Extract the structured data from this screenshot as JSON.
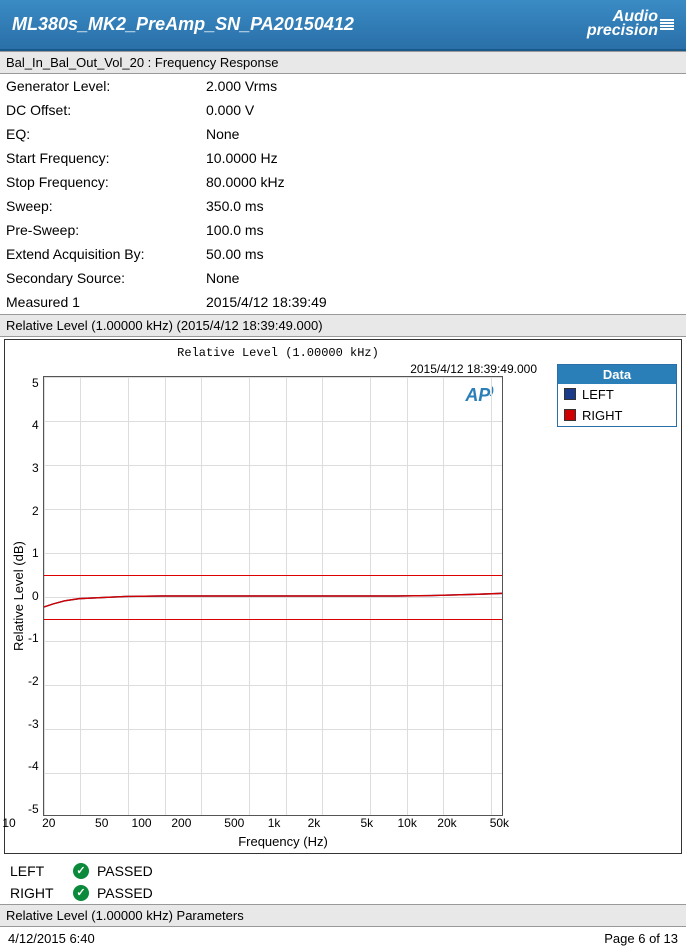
{
  "header": {
    "title": "ML380s_MK2_PreAmp_SN_PA20150412",
    "logo_top": "Audio",
    "logo_bottom": "precision"
  },
  "section1_title": "Bal_In_Bal_Out_Vol_20 : Frequency Response",
  "params": [
    {
      "label": "Generator Level:",
      "value": "2.000 Vrms"
    },
    {
      "label": "DC Offset:",
      "value": "0.000 V"
    },
    {
      "label": "EQ:",
      "value": "None"
    },
    {
      "label": "Start Frequency:",
      "value": "10.0000 Hz"
    },
    {
      "label": "Stop Frequency:",
      "value": "80.0000 kHz"
    },
    {
      "label": "Sweep:",
      "value": "350.0 ms"
    },
    {
      "label": "Pre-Sweep:",
      "value": "100.0 ms"
    },
    {
      "label": "Extend Acquisition By:",
      "value": "50.00 ms"
    },
    {
      "label": "Secondary Source:",
      "value": "None"
    },
    {
      "label": "Measured 1",
      "value": "2015/4/12 18:39:49"
    }
  ],
  "section2_title": "Relative Level (1.00000 kHz) (2015/4/12 18:39:49.000)",
  "chart": {
    "top_title": "Relative Level (1.00000 kHz)",
    "timestamp": "2015/4/12 18:39:49.000",
    "ap_badge": "AP",
    "y_label": "Relative Level (dB)",
    "x_label": "Frequency (Hz)",
    "y_ticks": [
      "5",
      "4",
      "3",
      "2",
      "1",
      "0",
      "-1",
      "-2",
      "-3",
      "-4",
      "-5"
    ],
    "x_ticks": [
      {
        "label": "10",
        "pct": 0
      },
      {
        "label": "20",
        "pct": 7.9
      },
      {
        "label": "50",
        "pct": 18.4
      },
      {
        "label": "100",
        "pct": 26.3
      },
      {
        "label": "200",
        "pct": 34.2
      },
      {
        "label": "500",
        "pct": 44.7
      },
      {
        "label": "1k",
        "pct": 52.6
      },
      {
        "label": "2k",
        "pct": 60.5
      },
      {
        "label": "5k",
        "pct": 71.0
      },
      {
        "label": "10k",
        "pct": 79.0
      },
      {
        "label": "20k",
        "pct": 86.9
      },
      {
        "label": "50k",
        "pct": 97.3
      }
    ],
    "legend": {
      "header": "Data",
      "items": [
        {
          "name": "LEFT",
          "color": "#1a3a8a"
        },
        {
          "name": "RIGHT",
          "color": "#d00000"
        }
      ]
    }
  },
  "results": [
    {
      "channel": "LEFT",
      "status": "PASSED"
    },
    {
      "channel": "RIGHT",
      "status": "PASSED"
    }
  ],
  "section3_title": "Relative Level (1.00000 kHz) Parameters",
  "footer": {
    "datetime": "4/12/2015 6:40",
    "page": "Page 6 of 13"
  },
  "chart_data": {
    "type": "line",
    "title": "Relative Level (1.00000 kHz)",
    "xlabel": "Frequency (Hz)",
    "ylabel": "Relative Level (dB)",
    "x_scale": "log",
    "xlim": [
      10,
      80000
    ],
    "ylim": [
      -5,
      5
    ],
    "upper_limit": 0.5,
    "lower_limit": -0.5,
    "series": [
      {
        "name": "LEFT",
        "color": "#1a3a8a",
        "x": [
          10,
          12,
          15,
          20,
          50,
          100,
          200,
          500,
          1000,
          2000,
          5000,
          10000,
          20000,
          50000,
          80000
        ],
        "values": [
          -0.25,
          -0.18,
          -0.11,
          -0.06,
          -0.01,
          0.0,
          0.0,
          0.0,
          0.0,
          0.0,
          0.0,
          0.0,
          0.01,
          0.04,
          0.06
        ]
      },
      {
        "name": "RIGHT",
        "color": "#d00000",
        "x": [
          10,
          12,
          15,
          20,
          50,
          100,
          200,
          500,
          1000,
          2000,
          5000,
          10000,
          20000,
          50000,
          80000
        ],
        "values": [
          -0.25,
          -0.18,
          -0.11,
          -0.06,
          -0.01,
          0.0,
          0.0,
          0.0,
          0.0,
          0.0,
          0.0,
          0.0,
          0.01,
          0.04,
          0.06
        ]
      }
    ]
  }
}
